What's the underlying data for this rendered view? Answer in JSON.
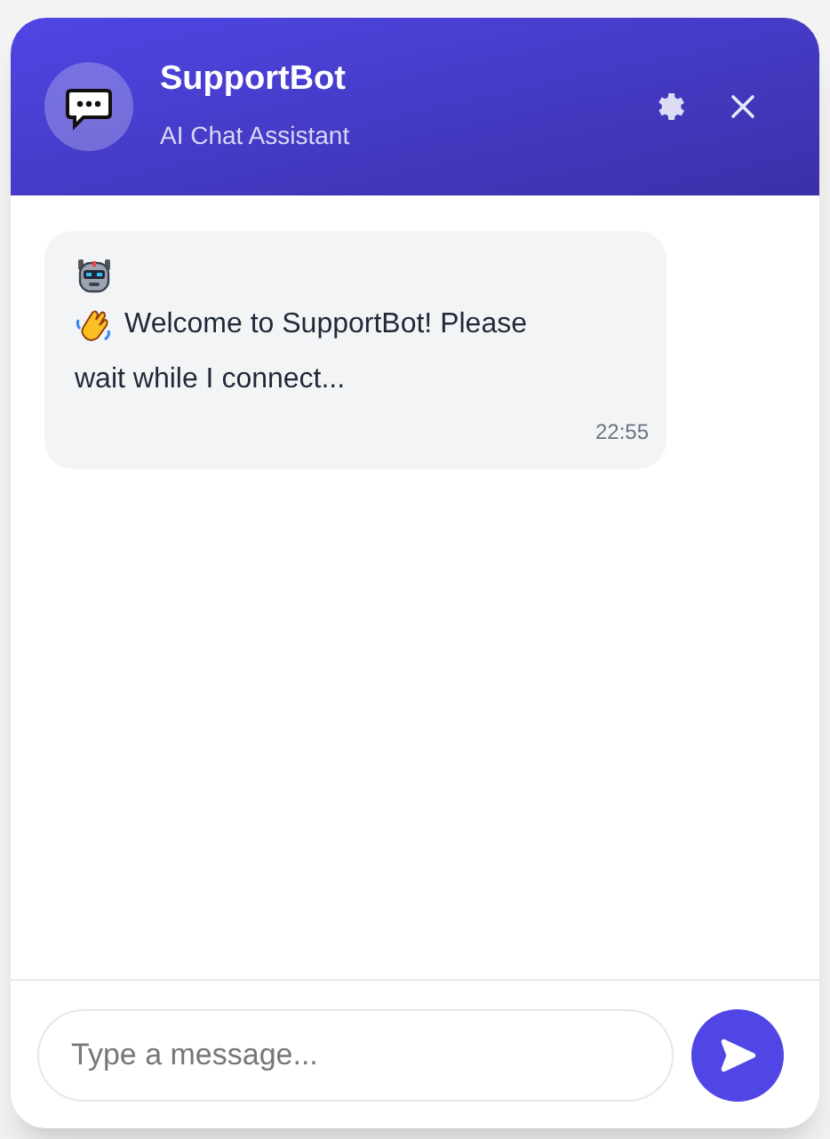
{
  "header": {
    "title": "SupportBot",
    "subtitle": "AI Chat Assistant"
  },
  "messages": [
    {
      "lines": [
        "Welcome to SupportBot! Please",
        "wait while I connect..."
      ],
      "time": "22:55"
    }
  ],
  "composer": {
    "placeholder": "Type a message..."
  }
}
